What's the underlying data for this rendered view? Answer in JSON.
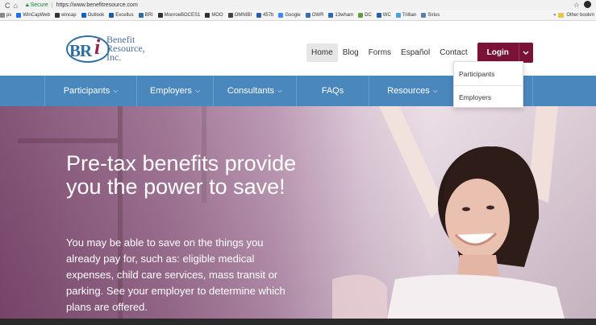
{
  "browser": {
    "secure_label": "Secure",
    "url": "https://www.benefitresource.com",
    "bookmarks": [
      {
        "label": "ps",
        "color": "#888888"
      },
      {
        "label": "WinCapWeb",
        "color": "#1a73e8"
      },
      {
        "label": "wincap",
        "color": "#333333"
      },
      {
        "label": "Outlook",
        "color": "#0a64c8"
      },
      {
        "label": "Excellus",
        "color": "#1a5aa0"
      },
      {
        "label": "BRI",
        "color": "#2f6e9e"
      },
      {
        "label": "MonroeBOCES1",
        "color": "#333333"
      },
      {
        "label": "MOO",
        "color": "#333333"
      },
      {
        "label": "OMNIBI",
        "color": "#444444"
      },
      {
        "label": "457b",
        "color": "#2a5ea8"
      },
      {
        "label": "Google",
        "color": "#4285f4"
      },
      {
        "label": "OWR",
        "color": "#3a6bb5"
      },
      {
        "label": "13wham",
        "color": "#2a6bb5"
      },
      {
        "label": "DC",
        "color": "#5ba03a"
      },
      {
        "label": "WC",
        "color": "#2a5ea8"
      },
      {
        "label": "Trillian",
        "color": "#4aa3df"
      },
      {
        "label": "Sirius",
        "color": "#5a7fa8"
      }
    ],
    "more_label": "»",
    "other_bookmarks": "Other bookm"
  },
  "header": {
    "logo_text": [
      "Benefit",
      "Resource,",
      "Inc."
    ],
    "top_nav": [
      "Home",
      "Blog",
      "Forms",
      "Español",
      "Contact"
    ],
    "active_nav": "Home",
    "login_label": "Login"
  },
  "login_menu": [
    "Participants",
    "Employers"
  ],
  "main_nav": [
    {
      "label": "Participants",
      "dropdown": true
    },
    {
      "label": "Employers",
      "dropdown": true
    },
    {
      "label": "Consultants",
      "dropdown": true
    },
    {
      "label": "FAQs",
      "dropdown": false
    },
    {
      "label": "Resources",
      "dropdown": true
    }
  ],
  "hero": {
    "title": "Pre-tax benefits provide you the power to save!",
    "body": "You may be able to save on the things you already pay for, such as: eligible medical expenses, child care services, mass transit or parking. See your employer to determine which plans are offered."
  },
  "colors": {
    "brand_blue": "#4a87bd",
    "brand_maroon": "#7a1237",
    "logo_blue": "#2f6e9e",
    "logo_magenta": "#a0204e"
  },
  "icons": [
    "back-icon",
    "reload-icon",
    "home-icon",
    "lock-icon",
    "star-icon",
    "chevron-down-icon"
  ]
}
